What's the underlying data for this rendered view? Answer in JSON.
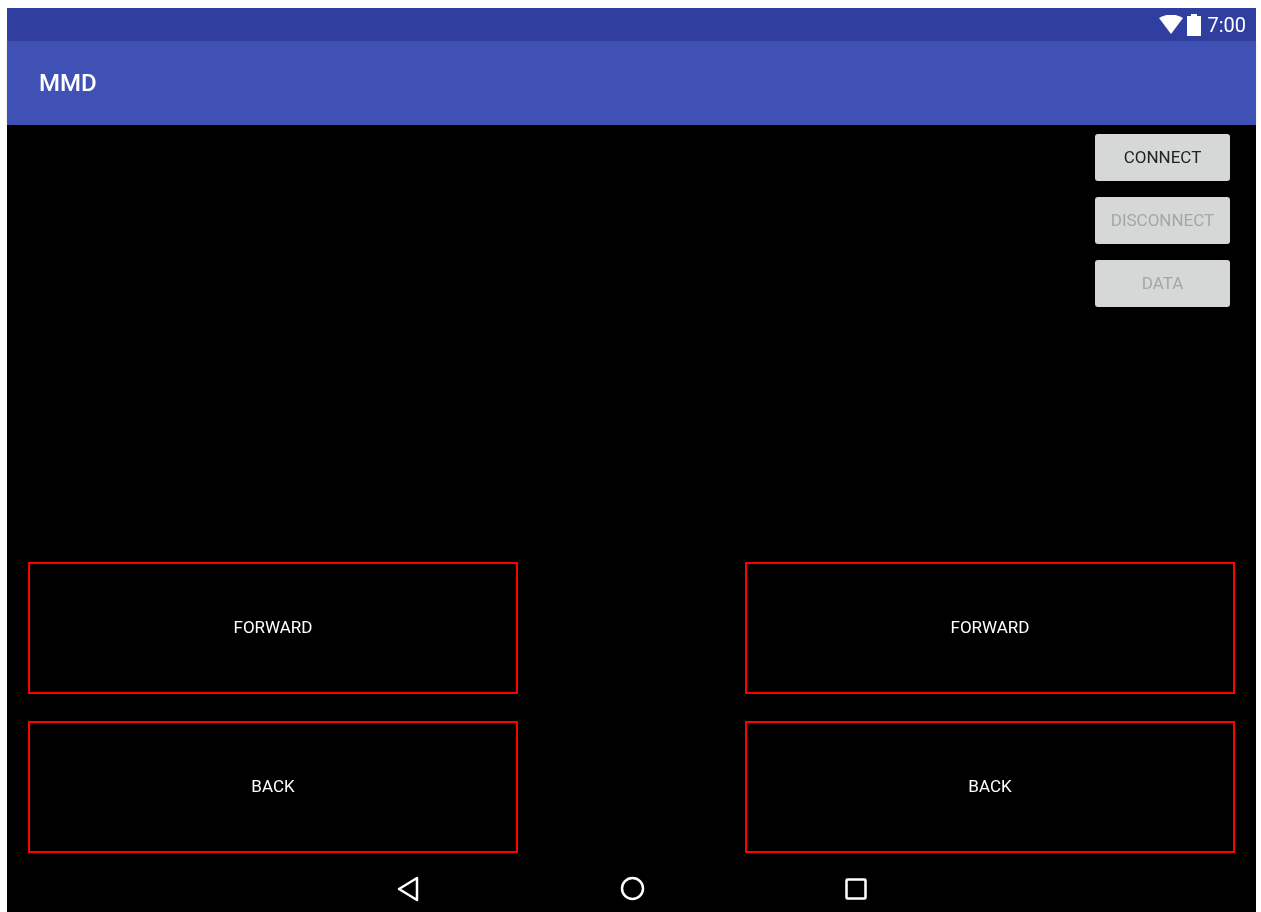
{
  "status_bar": {
    "time": "7:00"
  },
  "app_bar": {
    "title": "MMD"
  },
  "action_buttons": [
    {
      "label": "CONNECT",
      "disabled": false
    },
    {
      "label": "DISCONNECT",
      "disabled": true
    },
    {
      "label": "DATA",
      "disabled": true
    }
  ],
  "control_columns": [
    {
      "buttons": [
        {
          "label": "FORWARD"
        },
        {
          "label": "BACK"
        }
      ]
    },
    {
      "buttons": [
        {
          "label": "FORWARD"
        },
        {
          "label": "BACK"
        }
      ]
    }
  ]
}
